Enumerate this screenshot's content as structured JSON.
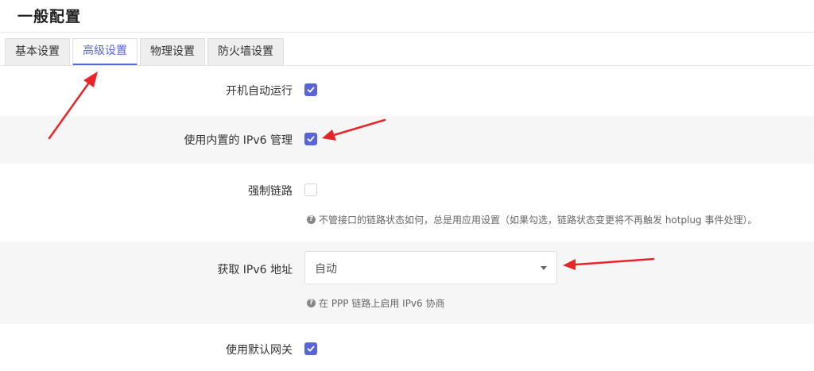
{
  "page": {
    "title": "一般配置"
  },
  "tabs": [
    {
      "label": "基本设置",
      "active": false
    },
    {
      "label": "高级设置",
      "active": true
    },
    {
      "label": "物理设置",
      "active": false
    },
    {
      "label": "防火墙设置",
      "active": false
    }
  ],
  "settings": {
    "autostart": {
      "label": "开机自动运行",
      "checked": true
    },
    "ipv6_builtin": {
      "label": "使用内置的 IPv6 管理",
      "checked": true
    },
    "force_link": {
      "label": "强制链路",
      "checked": false,
      "hint": "不管接口的链路状态如何，总是用应用设置（如果勾选，链路状态变更将不再触发 hotplug 事件处理）。"
    },
    "ipv6_address": {
      "label": "获取 IPv6 地址",
      "value": "自动",
      "hint": "在 PPP 链路上启用 IPv6 协商"
    },
    "default_gateway": {
      "label": "使用默认网关",
      "checked": true
    }
  },
  "icons": {
    "hint": "question-circle-icon",
    "check": "checkmark-icon",
    "dropdown": "caret-down-icon"
  },
  "colors": {
    "accent": "#5865d8",
    "annotation_arrow": "#e8262a"
  }
}
